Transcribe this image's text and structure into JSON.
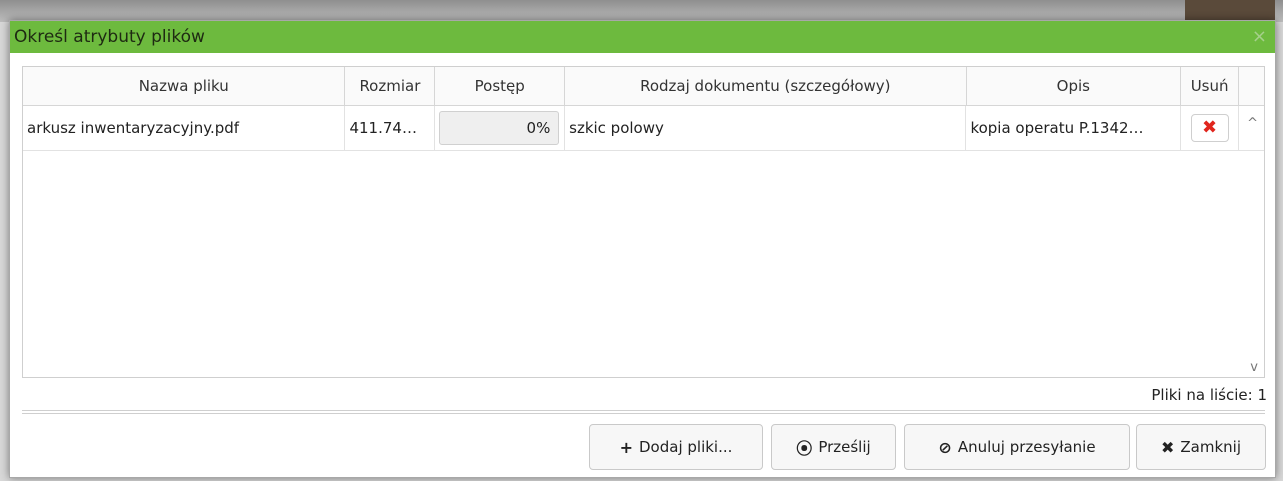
{
  "dialog": {
    "title": "Określ atrybuty plików",
    "close_icon": "×"
  },
  "table": {
    "columns": [
      "Nazwa pliku",
      "Rozmiar",
      "Postęp",
      "Rodzaj dokumentu (szczegółowy)",
      "Opis",
      "Usuń"
    ],
    "rows": [
      {
        "name": "arkusz inwentaryzacyjny.pdf",
        "size": "411.74…",
        "progress": "0%",
        "type": "szkic polowy",
        "description": "kopia operatu P.1342…",
        "delete_icon": "✖"
      }
    ]
  },
  "scroll": {
    "up": "^",
    "down": "v"
  },
  "status": {
    "count_text": "Pliki na liście: 1"
  },
  "buttons": {
    "add": {
      "icon": "+",
      "label": "Dodaj pliki..."
    },
    "send": {
      "icon": "⦿",
      "label": "Prześlij"
    },
    "cancel": {
      "icon": "⊘",
      "label": "Anuluj przesyłanie"
    },
    "close": {
      "icon": "✖",
      "label": "Zamknij"
    }
  },
  "colors": {
    "titlebar": "#6dba3e",
    "delete": "#e0251d"
  }
}
